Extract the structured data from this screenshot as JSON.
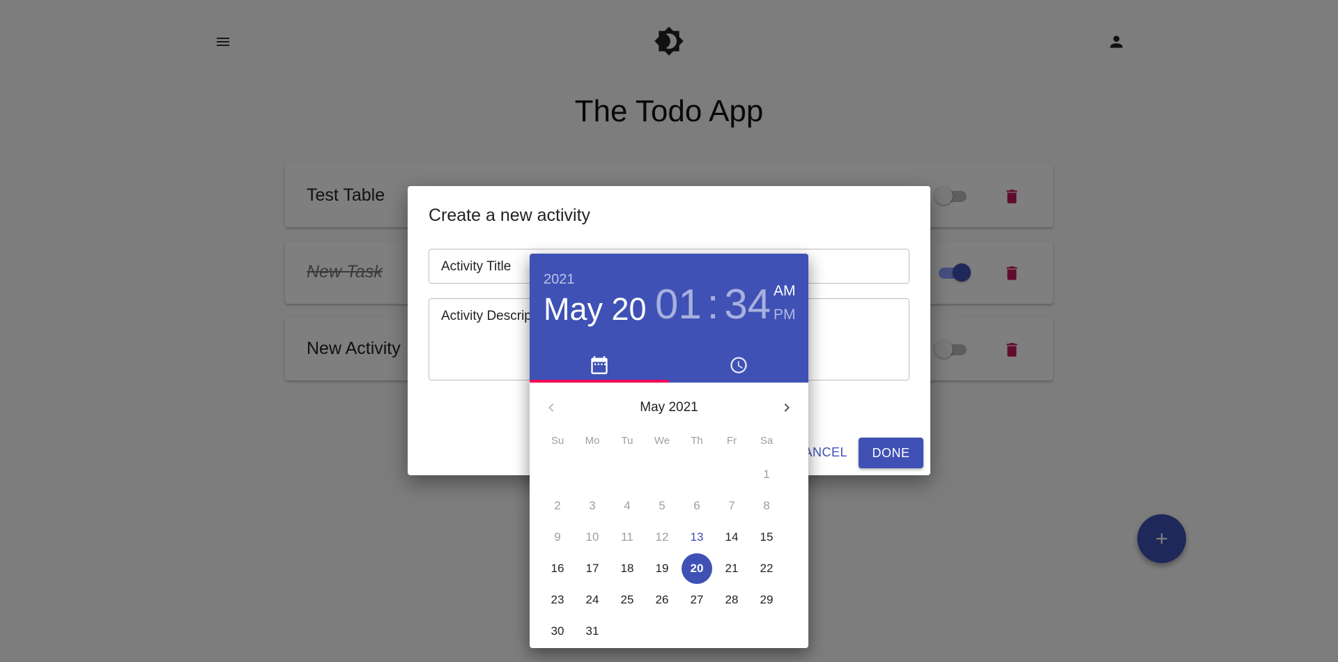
{
  "app": {
    "title": "The Todo App",
    "menu_icon": "menu-icon",
    "theme_icon": "brightness-icon",
    "user_icon": "person-icon"
  },
  "todos": [
    {
      "title": "Test Table",
      "done": false
    },
    {
      "title": "New Task",
      "done": true
    },
    {
      "title": "New Activity",
      "done": false
    }
  ],
  "dialog": {
    "title": "Create a new activity",
    "title_placeholder": "Activity Title",
    "description_placeholder": "Activity Description",
    "cancel_label": "CANCEL",
    "done_label": "DONE"
  },
  "picker": {
    "year": "2021",
    "date": "May 20",
    "hour": "01",
    "minute": "34",
    "am": "AM",
    "pm": "PM",
    "selected_meridiem": "AM",
    "month_label": "May 2021",
    "weekdays": [
      "Su",
      "Mo",
      "Tu",
      "We",
      "Th",
      "Fr",
      "Sa"
    ],
    "first_weekday_index": 6,
    "days_in_month": 31,
    "today": 13,
    "selected": 20,
    "first_enabled_day": 13
  },
  "colors": {
    "primary": "#3f51b5",
    "accent": "#f50057",
    "danger": "#c2185b"
  }
}
